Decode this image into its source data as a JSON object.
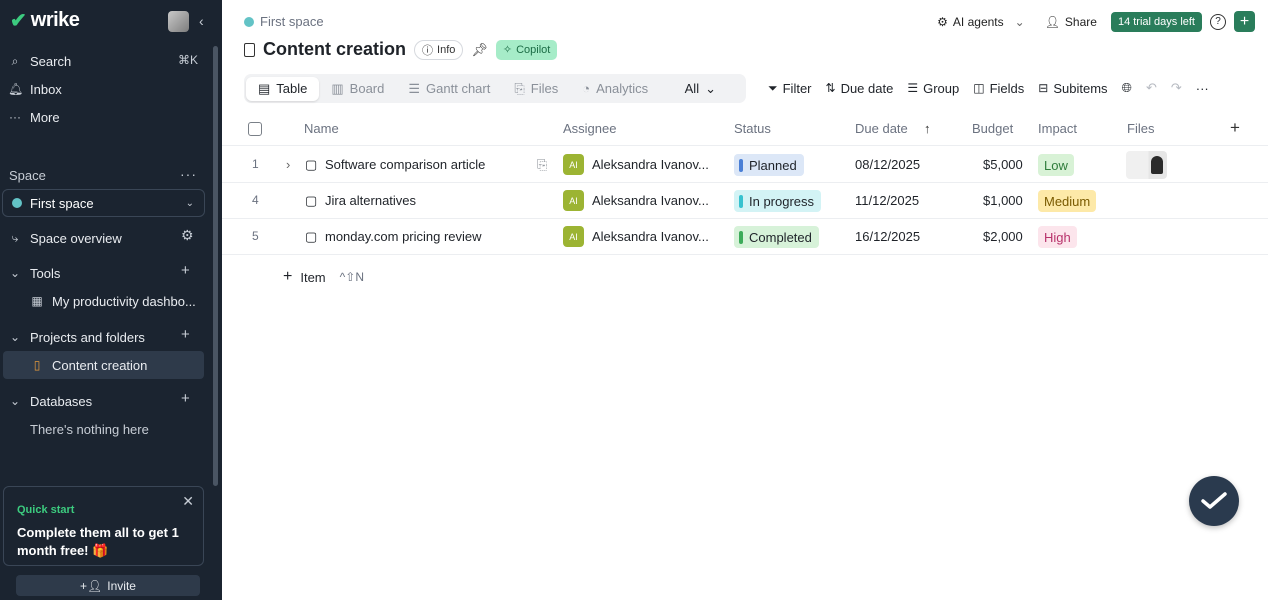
{
  "brand": {
    "name": "wrike"
  },
  "sidebar": {
    "search_label": "Search",
    "search_shortcut": "⌘K",
    "inbox_label": "Inbox",
    "more_label": "More",
    "space_section_label": "Space",
    "space_selected": "First space",
    "space_overview_label": "Space overview",
    "tools_label": "Tools",
    "tools_item": "My productivity dashbo...",
    "projects_label": "Projects and folders",
    "projects_item": "Content creation",
    "databases_label": "Databases",
    "databases_empty": "There's nothing here",
    "quick_start": {
      "title": "Quick start",
      "body": "Complete them all to get 1 month free! 🎁"
    },
    "invite_label": "Invite"
  },
  "header": {
    "breadcrumb": "First space",
    "title": "Content creation",
    "info_label": "Info",
    "copilot_label": "Copilot",
    "ai_agents_label": "AI agents",
    "share_label": "Share",
    "trial_label": "14 trial days left"
  },
  "tabs": {
    "table": "Table",
    "board": "Board",
    "gantt": "Gantt chart",
    "files": "Files",
    "analytics": "Analytics",
    "all": "All"
  },
  "toolbar": {
    "filter": "Filter",
    "due_date": "Due date",
    "group": "Group",
    "fields": "Fields",
    "subitems": "Subitems"
  },
  "table": {
    "columns": {
      "name": "Name",
      "assignee": "Assignee",
      "status": "Status",
      "due_date": "Due date",
      "budget": "Budget",
      "impact": "Impact",
      "files": "Files"
    },
    "rows": [
      {
        "num": "1",
        "name": "Software comparison article",
        "avatar": "AI",
        "assignee": "Aleksandra Ivanov...",
        "status": "Planned",
        "due": "08/12/2025",
        "budget": "$5,000",
        "impact": "Low"
      },
      {
        "num": "4",
        "name": "Jira alternatives",
        "avatar": "AI",
        "assignee": "Aleksandra Ivanov...",
        "status": "In progress",
        "due": "11/12/2025",
        "budget": "$1,000",
        "impact": "Medium"
      },
      {
        "num": "5",
        "name": "monday.com pricing review",
        "avatar": "AI",
        "assignee": "Aleksandra Ivanov...",
        "status": "Completed",
        "due": "16/12/2025",
        "budget": "$2,000",
        "impact": "High"
      }
    ],
    "add_item_label": "Item",
    "add_item_shortcut": "^⇧N"
  },
  "colors": {
    "sidebar_bg": "#1b2430",
    "accent_green": "#2a7d5b",
    "planned": "#4a7fd6",
    "in_progress": "#37c2cf",
    "completed": "#3dab5a",
    "impact_low": "#d8f2d6",
    "impact_medium": "#fde9a8",
    "impact_high": "#fce5ec"
  }
}
